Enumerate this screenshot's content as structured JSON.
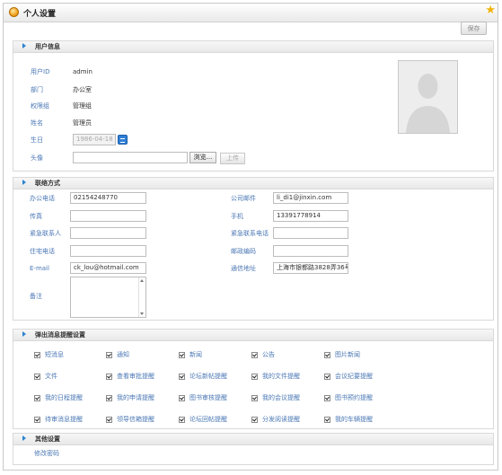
{
  "window": {
    "title": "个人设置"
  },
  "toolbar": {
    "save_label": "保存"
  },
  "user_info": {
    "section_title": "用户信息",
    "user_id_label": "用户ID",
    "user_id": "admin",
    "dept_label": "部门",
    "dept": "办公室",
    "role_label": "权限组",
    "role": "管理组",
    "name_label": "姓名",
    "name": "管理员",
    "birthday_label": "生日",
    "birthday": "1986-04-18",
    "avatar_label": "头像",
    "browse_label": "浏览...",
    "upload_label": "上传"
  },
  "contact": {
    "section_title": "联络方式",
    "left": [
      {
        "label": "办公电话",
        "value": "02154248770"
      },
      {
        "label": "传真",
        "value": ""
      },
      {
        "label": "紧急联系人",
        "value": ""
      },
      {
        "label": "住宅电话",
        "value": ""
      },
      {
        "label": "E-mail",
        "value": "ck_lou@hotmail.com"
      }
    ],
    "right": [
      {
        "label": "公司邮件",
        "value": "li_di1@jinxin.com"
      },
      {
        "label": "手机",
        "value": "13391778914"
      },
      {
        "label": "紧急联系电话",
        "value": ""
      },
      {
        "label": "邮政编码",
        "value": ""
      },
      {
        "label": "通信地址",
        "value": "上海市银都路3828弄36号202"
      }
    ],
    "notes_label": "备注"
  },
  "popup": {
    "section_title": "弹出消息提醒设置",
    "rows": [
      [
        "短消息",
        "通知",
        "新闻",
        "公告",
        "图片新闻"
      ],
      [
        "文件",
        "查看审批提醒",
        "论坛新帖提醒",
        "我的文件提醒",
        "会议纪要提醒"
      ],
      [
        "我的日程提醒",
        "我的申请提醒",
        "图书审核提醒",
        "我的会议提醒",
        "图书预约提醒"
      ],
      [
        "待审消息提醒",
        "领导信箱提醒",
        "论坛回帖提醒",
        "分发阅读提醒",
        "我的车辆提醒"
      ]
    ]
  },
  "other": {
    "section_title": "其他设置",
    "change_password": "修改密码"
  },
  "icons": {
    "title": "settings-icon",
    "favorite": "star-icon",
    "calendar": "calendar-icon",
    "section": "triangle-right-icon"
  }
}
